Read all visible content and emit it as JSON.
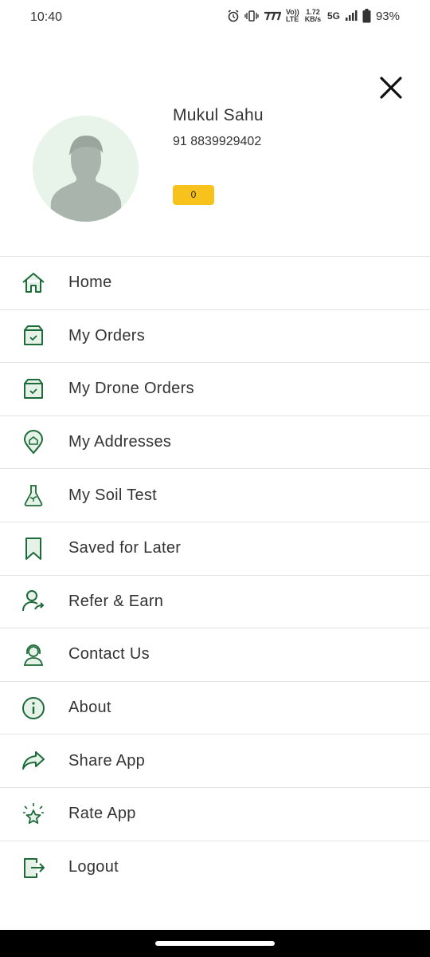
{
  "status_bar": {
    "time": "10:40",
    "volte": "Vo)) LTE",
    "speed": "1.72 KB/s",
    "network": "5G",
    "battery": "93%"
  },
  "profile": {
    "name": "Mukul Sahu",
    "phone": "91 8839929402",
    "points": "0"
  },
  "menu": {
    "items": [
      {
        "label": "Home",
        "icon": "home-icon"
      },
      {
        "label": "My Orders",
        "icon": "order-box-icon"
      },
      {
        "label": "My Drone Orders",
        "icon": "drone-order-box-icon"
      },
      {
        "label": "My Addresses",
        "icon": "location-pin-icon"
      },
      {
        "label": "My Soil Test",
        "icon": "flask-icon"
      },
      {
        "label": "Saved for Later",
        "icon": "bookmark-icon"
      },
      {
        "label": "Refer & Earn",
        "icon": "refer-user-icon"
      },
      {
        "label": "Contact Us",
        "icon": "support-agent-icon"
      },
      {
        "label": "About",
        "icon": "info-icon"
      },
      {
        "label": "Share App",
        "icon": "share-arrow-icon"
      },
      {
        "label": "Rate App",
        "icon": "star-icon"
      },
      {
        "label": "Logout",
        "icon": "logout-icon"
      }
    ]
  },
  "colors": {
    "icon_green": "#1e6b3a",
    "badge_yellow": "#f8c21c",
    "avatar_bg": "#e8f4ea",
    "avatar_silhouette": "#a9b5ac"
  }
}
